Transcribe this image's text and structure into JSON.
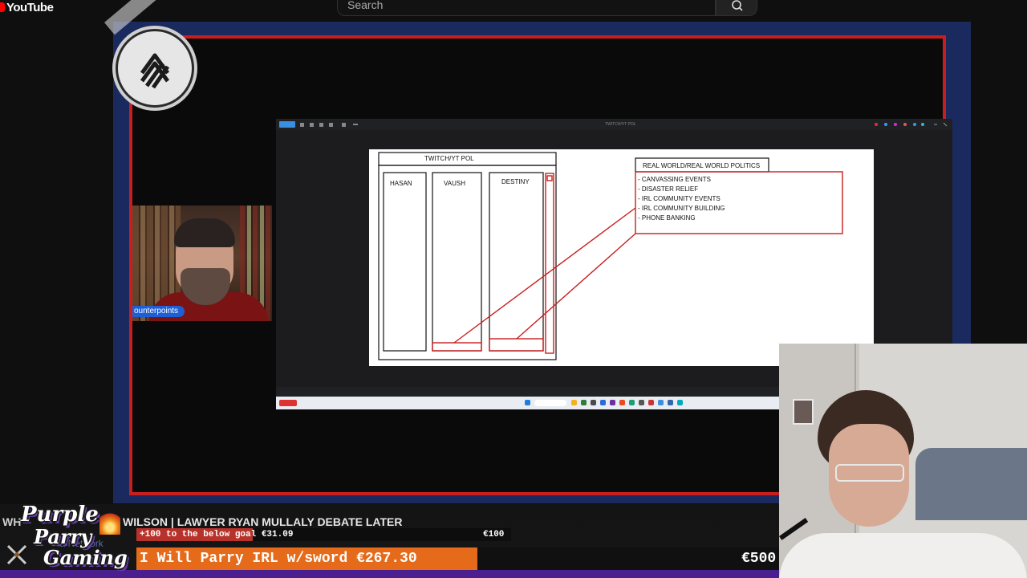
{
  "youtube": {
    "logo_text": "YouTube",
    "search_placeholder": "Search",
    "icons": [
      "youtube-logo-icon",
      "search-icon"
    ]
  },
  "whiteboard": {
    "window_title": "TWITCH/YT POL",
    "left_group_title": "TWITCH/YT POL",
    "columns": [
      "HASAN",
      "VAUSH",
      "DESTINY"
    ],
    "right_title": "REAL WORLD/REAL WORLD POLITICS",
    "right_items": [
      "- CANVASSING EVENTS",
      "- DISASTER RELIEF",
      "- IRL COMMUNITY EVENTS",
      "- IRL COMMUNITY BUILDING",
      "- PHONE BANKING"
    ],
    "colors": {
      "outline": "#111111",
      "accent": "#c81e1e"
    }
  },
  "webcam_left": {
    "name_label": "ounterpoints"
  },
  "overlay": {
    "ticker_prefix": "WH",
    "ticker_text": "WILSON | LAWYER RYAN MULLALY DEBATE LATER",
    "network_text": "ia Network",
    "brand_lines": [
      "Purple",
      "Parry",
      "Gaming"
    ],
    "goal_small": {
      "left": "+100 to the below goal  €31.09",
      "right": "€100",
      "progress": 0.31
    },
    "goal_big": {
      "left": "I Will Parry IRL w/sword €267.30",
      "right": "€500",
      "progress": 0.53
    },
    "colors": {
      "frame_blue": "#1b2a5e",
      "frame_red": "#c81e1e",
      "goal_orange": "#e56a1a",
      "goal_red": "#b8322c",
      "purple": "#4b1f8f"
    }
  }
}
